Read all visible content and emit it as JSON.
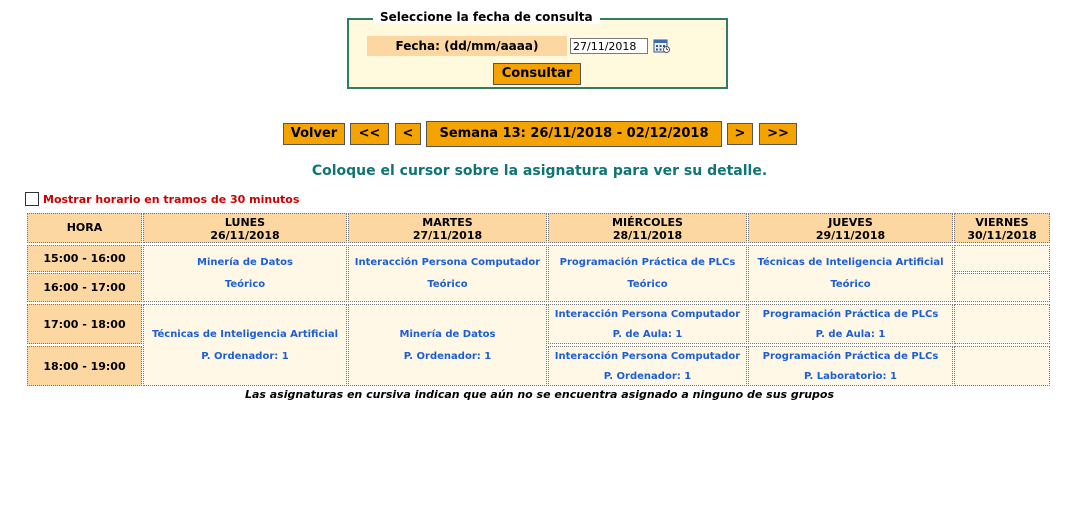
{
  "query": {
    "legend": "Seleccione la fecha de consulta",
    "date_label": "Fecha: (dd/mm/aaaa)",
    "date_value": "27/11/2018",
    "submit_label": "Consultar",
    "calendar_icon": "calendar-icon"
  },
  "nav": {
    "back_label": "Volver",
    "prev_prev_label": "<<",
    "prev_label": "<",
    "week_label": "Semana 13: 26/11/2018 - 02/12/2018",
    "next_label": ">",
    "next_next_label": ">>"
  },
  "instruction": "Coloque el cursor sobre la asignatura para ver su detalle.",
  "half_hour_option": {
    "label": "Mostrar horario en tramos de 30 minutos",
    "checked": false
  },
  "timetable": {
    "hour_header": "HORA",
    "days": [
      {
        "name": "LUNES",
        "date": "26/11/2018"
      },
      {
        "name": "MARTES",
        "date": "27/11/2018"
      },
      {
        "name": "MIÉRCOLES",
        "date": "28/11/2018"
      },
      {
        "name": "JUEVES",
        "date": "29/11/2018"
      },
      {
        "name": "VIERNES",
        "date": "30/11/2018"
      }
    ],
    "hours": [
      "15:00 - 16:00",
      "16:00 - 17:00",
      "17:00 - 18:00",
      "18:00 - 19:00"
    ],
    "classes": {
      "mon_1": {
        "subject": "Minería de Datos",
        "type": "Teórico"
      },
      "tue_1": {
        "subject": "Interacción Persona Computador",
        "type": "Teórico"
      },
      "wed_1": {
        "subject": "Programación Práctica de PLCs",
        "type": "Teórico"
      },
      "thu_1": {
        "subject": "Técnicas de Inteligencia Artificial",
        "type": "Teórico"
      },
      "mon_2": {
        "subject": "Técnicas de Inteligencia Artificial",
        "type": "P. Ordenador: 1"
      },
      "tue_2": {
        "subject": "Minería de Datos",
        "type": "P. Ordenador: 1"
      },
      "wed_3": {
        "subject": "Interacción Persona Computador",
        "type": "P. de Aula: 1"
      },
      "thu_3": {
        "subject": "Programación Práctica de PLCs",
        "type": "P. de Aula: 1"
      },
      "wed_4": {
        "subject": "Interacción Persona Computador",
        "type": "P. Ordenador: 1"
      },
      "thu_4": {
        "subject": "Programación Práctica de PLCs",
        "type": "P. Laboratorio: 1"
      }
    }
  },
  "footnote": "Las asignaturas en cursiva indican que aún no se encuentra asignado a ninguno de sus grupos",
  "colors": {
    "accent": "#f5a300",
    "header": "#fcd7a2",
    "cell": "#fff8e6",
    "link": "#1c5fd4",
    "teal": "#0f7474",
    "warning": "#cc0000"
  }
}
